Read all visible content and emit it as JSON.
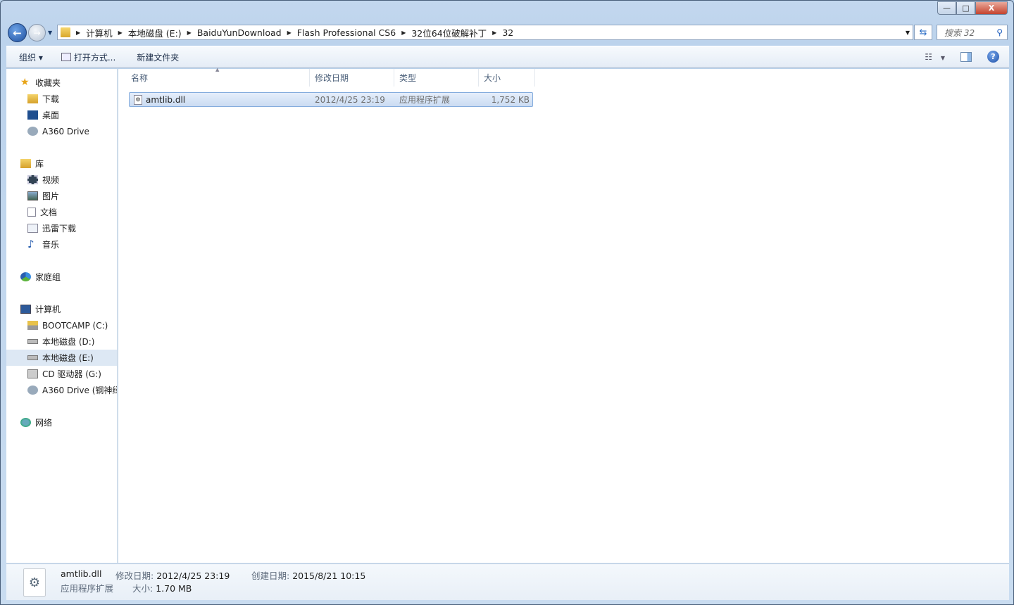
{
  "window": {
    "minimize": "—",
    "maximize": "□",
    "close": "X"
  },
  "address": {
    "crumbs": [
      "计算机",
      "本地磁盘 (E:)",
      "BaiduYunDownload",
      "Flash Professional CS6",
      "32位64位破解补丁",
      "32"
    ]
  },
  "search": {
    "placeholder": "搜索 32"
  },
  "toolbar": {
    "organize": "组织 ▾",
    "open_with": "打开方式...",
    "new_folder": "新建文件夹"
  },
  "sidebar": {
    "favorites": {
      "label": "收藏夹",
      "items": [
        "下载",
        "桌面",
        "A360 Drive"
      ]
    },
    "libraries": {
      "label": "库",
      "items": [
        "视频",
        "图片",
        "文档",
        "迅雷下载",
        "音乐"
      ]
    },
    "homegroup": {
      "label": "家庭组"
    },
    "computer": {
      "label": "计算机",
      "items": [
        "BOOTCAMP (C:)",
        "本地磁盘 (D:)",
        "本地磁盘 (E:)",
        "CD 驱动器 (G:)",
        "A360 Drive (钢神绿"
      ],
      "selected": "本地磁盘 (E:)"
    },
    "network": {
      "label": "网络"
    }
  },
  "columns": [
    "名称",
    "修改日期",
    "类型",
    "大小"
  ],
  "files": [
    {
      "name": "amtlib.dll",
      "modified": "2012/4/25 23:19",
      "type": "应用程序扩展",
      "size": "1,752 KB"
    }
  ],
  "details": {
    "name": "amtlib.dll",
    "type": "应用程序扩展",
    "modified_label": "修改日期:",
    "modified": "2012/4/25 23:19",
    "size_label": "大小:",
    "size": "1.70 MB",
    "created_label": "创建日期:",
    "created": "2015/8/21 10:15"
  }
}
